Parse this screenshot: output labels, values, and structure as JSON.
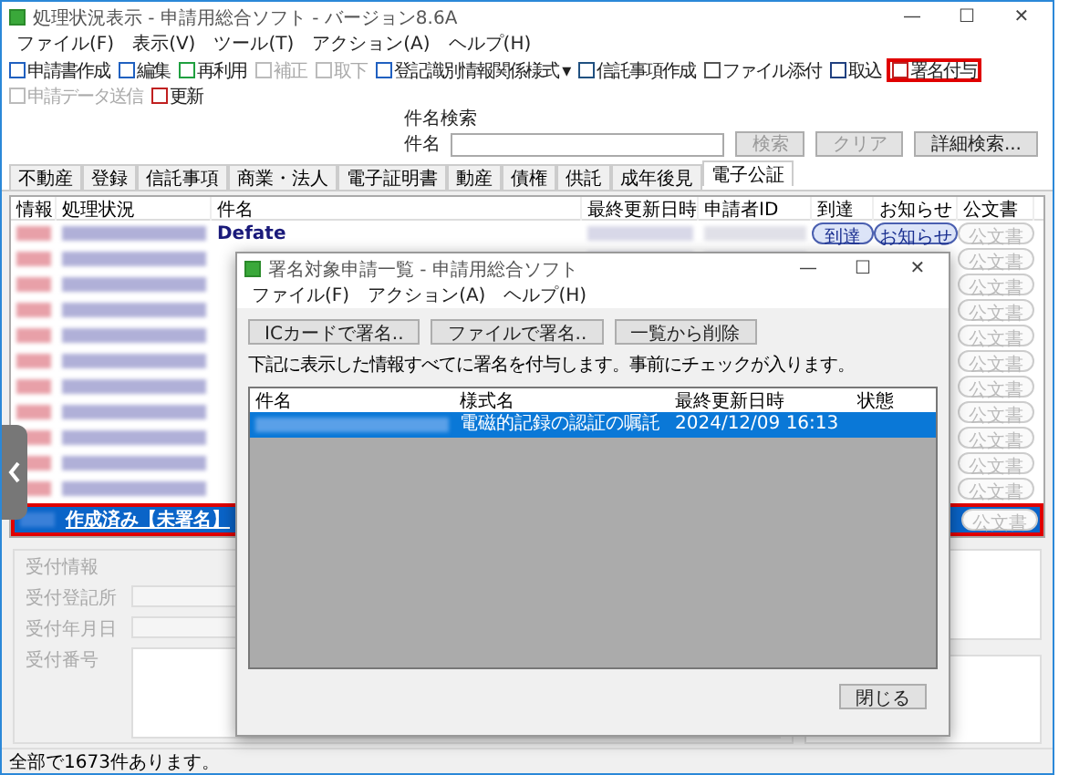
{
  "window": {
    "title": "処理状況表示 - 申請用総合ソフト - バージョン8.6A",
    "controls": [
      "—",
      "☐",
      "✕"
    ]
  },
  "menu": [
    "ファイル(F)",
    "表示(V)",
    "ツール(T)",
    "アクション(A)",
    "ヘルプ(H)"
  ],
  "toolbar": [
    {
      "label": "申請書作成",
      "disabled": false,
      "highlighted": false
    },
    {
      "label": "編集",
      "disabled": false,
      "highlighted": false
    },
    {
      "label": "再利用",
      "disabled": false,
      "highlighted": false
    },
    {
      "label": "補正",
      "disabled": true,
      "highlighted": false
    },
    {
      "label": "取下",
      "disabled": true,
      "highlighted": false
    },
    {
      "label": "登記識別情報関係様式 ▾",
      "disabled": false,
      "highlighted": false
    },
    {
      "label": "信託事項作成",
      "disabled": false,
      "highlighted": false
    },
    {
      "label": "ファイル添付",
      "disabled": false,
      "highlighted": false
    },
    {
      "label": "取込",
      "disabled": false,
      "highlighted": false
    },
    {
      "label": "署名付与",
      "disabled": false,
      "highlighted": true
    },
    {
      "label": "申請データ送信",
      "disabled": true,
      "highlighted": false
    },
    {
      "label": "更新",
      "disabled": false,
      "highlighted": false
    }
  ],
  "search": {
    "title": "件名検索",
    "label": "件名",
    "buttons": [
      {
        "label": "検索",
        "disabled": true
      },
      {
        "label": "クリア",
        "disabled": true
      },
      {
        "label": "詳細検索...",
        "disabled": false
      }
    ]
  },
  "tabs": [
    {
      "label": "不動産",
      "selected": false
    },
    {
      "label": "登録",
      "selected": false
    },
    {
      "label": "信託事項",
      "selected": false
    },
    {
      "label": "商業・法人",
      "selected": false
    },
    {
      "label": "電子証明書",
      "selected": false
    },
    {
      "label": "動産",
      "selected": false
    },
    {
      "label": "債権",
      "selected": false
    },
    {
      "label": "供託",
      "selected": false
    },
    {
      "label": "成年後見",
      "selected": false
    },
    {
      "label": "電子公証",
      "selected": true
    }
  ],
  "table": {
    "columns": [
      "情報",
      "処理状況",
      "件名",
      "最終更新日時",
      "申請者ID",
      "到達",
      "お知らせ",
      "公文書"
    ],
    "rows": [
      {
        "subject": "Defate",
        "arrival": "到達",
        "notice": "お知らせ",
        "document": "公文書",
        "selected": false,
        "highlighted": false
      },
      {
        "document": "公文書",
        "selected": false,
        "highlighted": false
      },
      {
        "document": "公文書",
        "selected": false,
        "highlighted": false
      },
      {
        "document": "公文書",
        "selected": false,
        "highlighted": false
      },
      {
        "document": "公文書",
        "selected": false,
        "highlighted": false
      },
      {
        "document": "公文書",
        "selected": false,
        "highlighted": false
      },
      {
        "document": "公文書",
        "selected": false,
        "highlighted": false
      },
      {
        "document": "公文書",
        "selected": false,
        "highlighted": false
      },
      {
        "document": "公文書",
        "selected": false,
        "highlighted": false
      },
      {
        "document": "公文書",
        "selected": false,
        "highlighted": false
      },
      {
        "document": "公文書",
        "selected": false,
        "highlighted": false
      },
      {
        "status": "作成済み【未署名】",
        "document": "公文書",
        "selected": true,
        "highlighted": true
      }
    ]
  },
  "receipt": {
    "title": "受付情報",
    "fields": [
      "受付登記所",
      "受付年月日",
      "受付番号"
    ]
  },
  "status_bar": "全部で1673件あります。",
  "dialog": {
    "title": "署名対象申請一覧 - 申請用総合ソフト",
    "controls": [
      "—",
      "☐",
      "✕"
    ],
    "menu": [
      "ファイル(F)",
      "アクション(A)",
      "ヘルプ(H)"
    ],
    "buttons": [
      "ICカードで署名..",
      "ファイルで署名..",
      "一覧から削除"
    ],
    "instruction": "下記に表示した情報すべてに署名を付与します。事前にチェックが入ります。",
    "columns": [
      "件名",
      "様式名",
      "最終更新日時",
      "状態"
    ],
    "rows": [
      {
        "form": "電磁的記録の認証の嘱託",
        "updated": "2024/12/09 16:13",
        "selected": true
      }
    ],
    "close": "閉じる"
  }
}
